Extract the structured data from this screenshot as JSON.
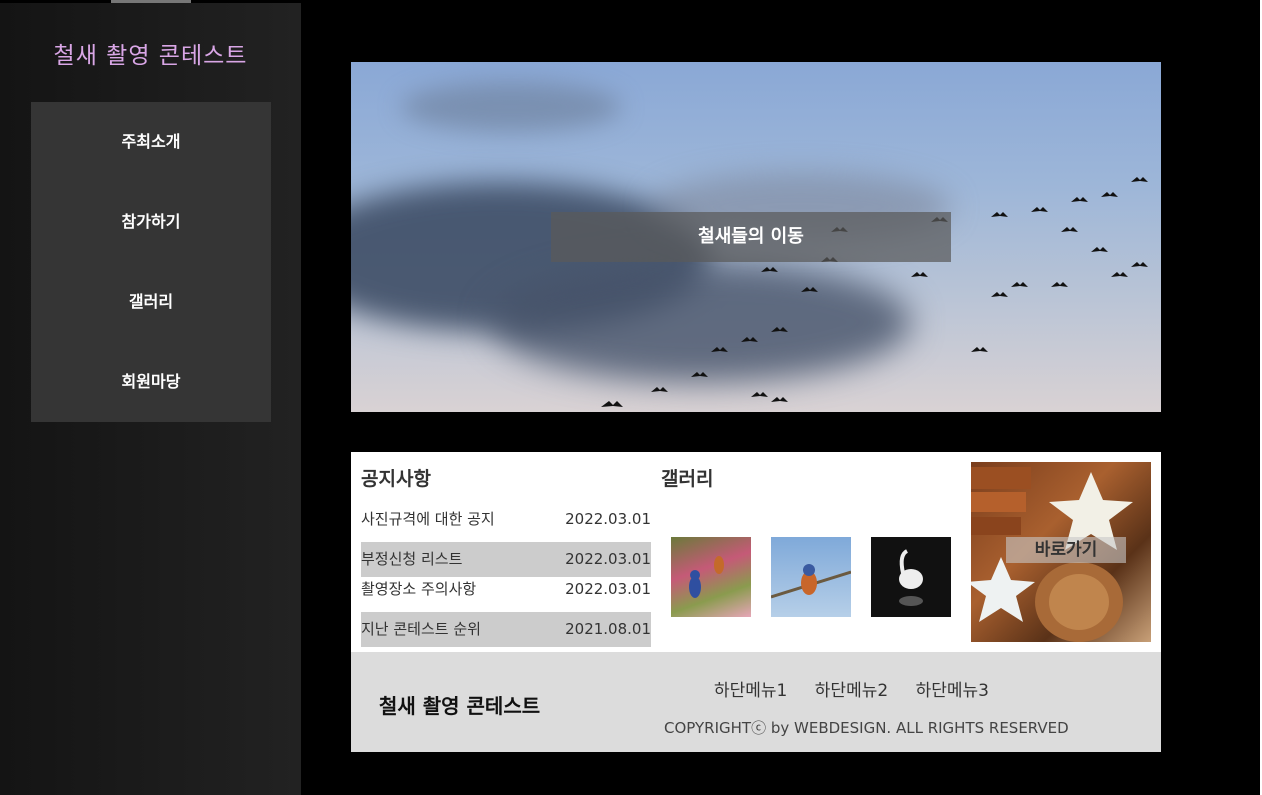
{
  "site_logo": "철새 촬영 콘테스트",
  "menu": [
    {
      "label": "주최소개"
    },
    {
      "label": "참가하기"
    },
    {
      "label": "갤러리"
    },
    {
      "label": "회원마당"
    }
  ],
  "hero": {
    "caption": "철새들의 이동"
  },
  "notice": {
    "title": "공지사항",
    "items": [
      {
        "title": "사진규격에 대한 공지",
        "date": "2022.03.01"
      },
      {
        "title": "부정신청 리스트",
        "date": "2022.03.01"
      },
      {
        "title": "촬영장소 주의사항",
        "date": "2022.03.01"
      },
      {
        "title": "지난 콘테스트 순위",
        "date": "2021.08.01"
      }
    ]
  },
  "gallery": {
    "title": "갤러리"
  },
  "shortcut": {
    "label": "바로가기"
  },
  "footer": {
    "logo": "철새 촬영 콘테스트",
    "menu": [
      "하단메뉴1",
      "하단메뉴2",
      "하단메뉴3"
    ],
    "copyright": "COPYRIGHTⓒ by WEBDESIGN. ALL RIGHTS RESERVED"
  }
}
